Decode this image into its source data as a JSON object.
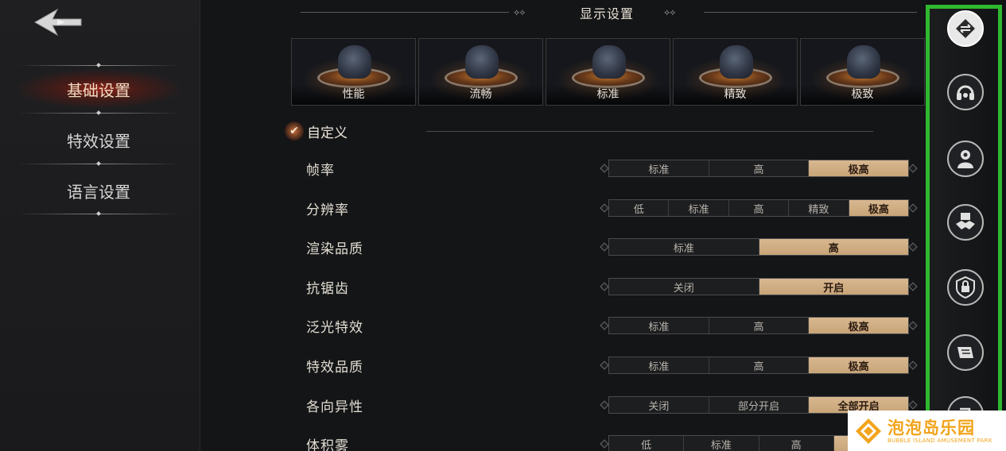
{
  "sidebar": {
    "items": [
      {
        "label": "基础设置",
        "active": true
      },
      {
        "label": "特效设置",
        "active": false
      },
      {
        "label": "语言设置",
        "active": false
      }
    ]
  },
  "main": {
    "title": "显示设置",
    "presets": [
      "性能",
      "流畅",
      "标准",
      "精致",
      "极致"
    ],
    "custom_label": "自定义",
    "settings": [
      {
        "label": "帧率",
        "options": [
          "标准",
          "高",
          "极高"
        ],
        "selected": 2
      },
      {
        "label": "分辨率",
        "options": [
          "低",
          "标准",
          "高",
          "精致",
          "极高"
        ],
        "selected": 4
      },
      {
        "label": "渲染品质",
        "options": [
          "标准",
          "高"
        ],
        "selected": 1
      },
      {
        "label": "抗锯齿",
        "options": [
          "关闭",
          "开启"
        ],
        "selected": 1
      },
      {
        "label": "泛光特效",
        "options": [
          "标准",
          "高",
          "极高"
        ],
        "selected": 2
      },
      {
        "label": "特效品质",
        "options": [
          "标准",
          "高",
          "极高"
        ],
        "selected": 2
      },
      {
        "label": "各向异性",
        "options": [
          "关闭",
          "部分开启",
          "全部开启"
        ],
        "selected": 2
      },
      {
        "label": "体积雾",
        "options": [
          "低",
          "标准",
          "高",
          "极高"
        ],
        "selected": 3
      }
    ]
  },
  "iconbar": {
    "icons": [
      "display-settings-icon",
      "audio-icon",
      "character-icon",
      "social-icon",
      "privacy-lock-icon",
      "notice-icon",
      "exit-icon"
    ]
  },
  "watermark": {
    "title": "泡泡岛乐园",
    "subtitle": "BUBBLE ISLAND AMUSEMENT PARK"
  },
  "colors": {
    "accent_selected": "#d8b890",
    "highlight_border": "#2fb82f",
    "sidebar_active_glow": "#aa2819",
    "watermark": "#f2a41c"
  }
}
